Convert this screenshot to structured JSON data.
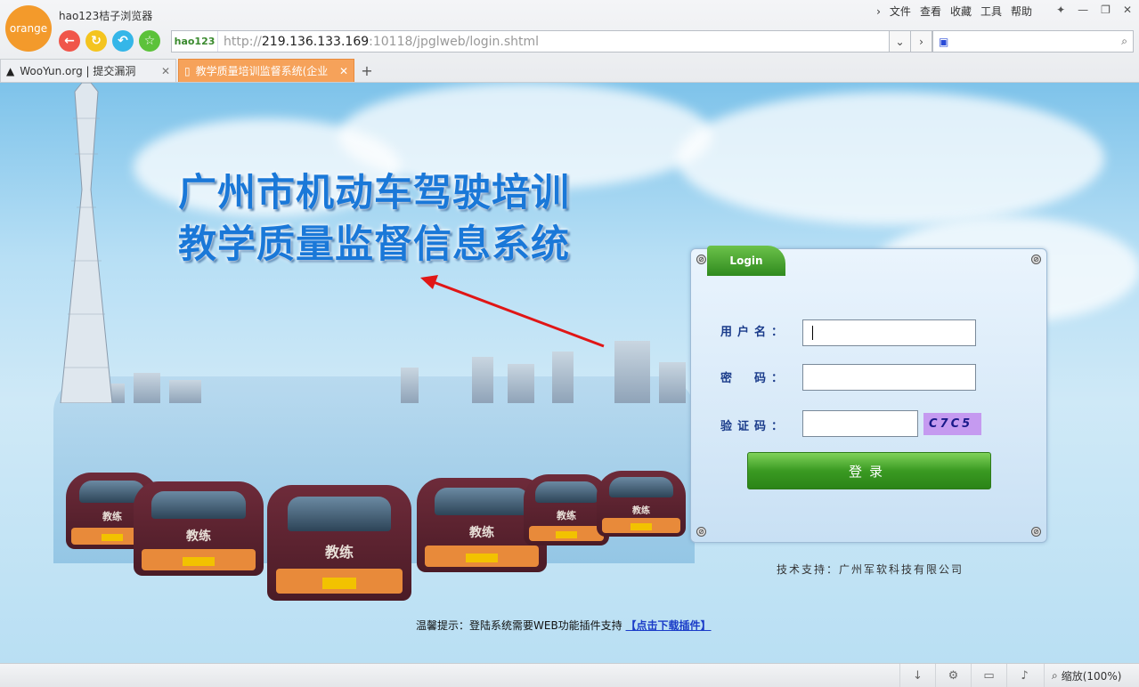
{
  "browser": {
    "logo_text": "orange",
    "app_name": "hao123桔子浏览器",
    "menu": [
      "文件",
      "查看",
      "收藏",
      "工具",
      "帮助"
    ],
    "hao_badge": "hao123",
    "url_prefix": "http://",
    "url_host": "219.136.133.169",
    "url_rest": ":10118/jpglweb/login.shtml",
    "tabs": [
      {
        "title": "WooYun.org | 提交漏洞",
        "active": false
      },
      {
        "title": "教学质量培训监督系统(企业",
        "active": true
      }
    ],
    "new_tab_label": "+"
  },
  "page": {
    "title_line1": "广州市机动车驾驶培训",
    "title_line2": "教学质量监督信息系统",
    "car_label": "教练",
    "login": {
      "tab_label": "Login",
      "username_label": "用户名：",
      "password_label": "密　码：",
      "captcha_label": "验证码：",
      "captcha_text": "C7C5",
      "submit_label": "登录"
    },
    "support_text": "技术支持：广州军软科技有限公司",
    "tip_text": "温馨提示：登陆系统需要WEB功能插件支持",
    "tip_link": "【点击下载插件】"
  },
  "status": {
    "zoom_text": "缩放(100%)"
  },
  "colors": {
    "accent_orange": "#f6a25a",
    "title_blue": "#1a78d8",
    "login_green": "#3a9a22",
    "captcha_bg": "#c59af0"
  }
}
